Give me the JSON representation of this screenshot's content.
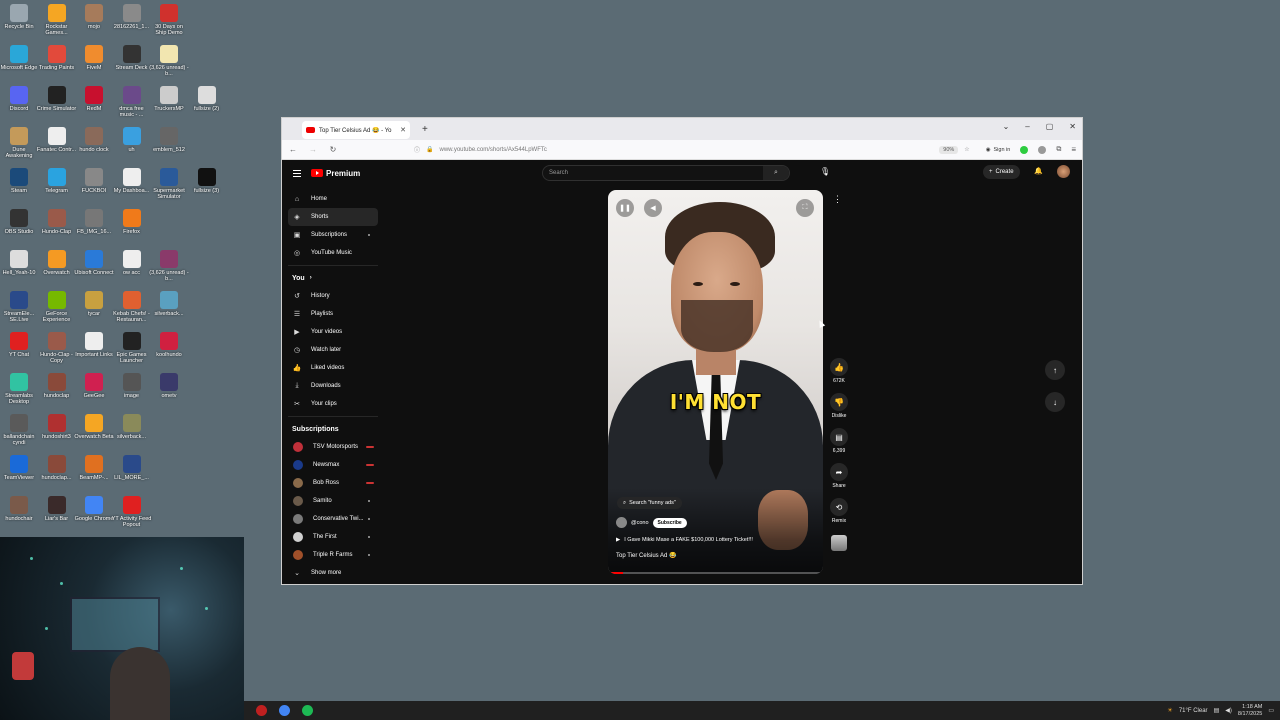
{
  "desktop": {
    "icons": [
      {
        "label": "Recycle Bin",
        "color": "#9aa7b0",
        "col": 0,
        "row": 0
      },
      {
        "label": "Rockstar Games...",
        "color": "#f5a623",
        "col": 1,
        "row": 0
      },
      {
        "label": "mojo",
        "color": "#a67b5b",
        "col": 2,
        "row": 0
      },
      {
        "label": "28162261_1...",
        "color": "#8a8a8a",
        "col": 3,
        "row": 0
      },
      {
        "label": "30 Days on Ship Demo",
        "color": "#d0312d",
        "col": 4,
        "row": 0
      },
      {
        "label": "Microsoft Edge",
        "color": "#2aa7d8",
        "col": 0,
        "row": 1
      },
      {
        "label": "Trading Paints",
        "color": "#e24a3b",
        "col": 1,
        "row": 1
      },
      {
        "label": "FiveM",
        "color": "#f08c2e",
        "col": 2,
        "row": 1
      },
      {
        "label": "Stream Deck",
        "color": "#333333",
        "col": 3,
        "row": 1
      },
      {
        "label": "(3,626 unread) - b...",
        "color": "#f2e6b0",
        "col": 4,
        "row": 1
      },
      {
        "label": "Discord",
        "color": "#5865f2",
        "col": 0,
        "row": 2
      },
      {
        "label": "Crime Simulator",
        "color": "#222222",
        "col": 1,
        "row": 2
      },
      {
        "label": "RedM",
        "color": "#c8102e",
        "col": 2,
        "row": 2
      },
      {
        "label": "dmca free music - ...",
        "color": "#6b4a8a",
        "col": 3,
        "row": 2
      },
      {
        "label": "TruckersMP",
        "color": "#cccccc",
        "col": 4,
        "row": 2
      },
      {
        "label": "fullsize (2)",
        "color": "#dddddd",
        "col": 5,
        "row": 2
      },
      {
        "label": "Dune Awakening",
        "color": "#c49a5a",
        "col": 0,
        "row": 3
      },
      {
        "label": "Fanatec Contr...",
        "color": "#eeeeee",
        "col": 1,
        "row": 3
      },
      {
        "label": "hundo clock",
        "color": "#8a6a5a",
        "col": 2,
        "row": 3
      },
      {
        "label": "uh",
        "color": "#3aa0e0",
        "col": 3,
        "row": 3
      },
      {
        "label": "emblem_512",
        "color": "#666666",
        "col": 4,
        "row": 3
      },
      {
        "label": "Steam",
        "color": "#1b4a7a",
        "col": 0,
        "row": 4
      },
      {
        "label": "Telegram",
        "color": "#2aa3e0",
        "col": 1,
        "row": 4
      },
      {
        "label": "FUCKBOI",
        "color": "#888888",
        "col": 2,
        "row": 4
      },
      {
        "label": "My Dashboa...",
        "color": "#eeeeee",
        "col": 3,
        "row": 4
      },
      {
        "label": "Supermarket Simulator",
        "color": "#2a5a9a",
        "col": 4,
        "row": 4
      },
      {
        "label": "fullsize (3)",
        "color": "#111111",
        "col": 5,
        "row": 4
      },
      {
        "label": "OBS Studio",
        "color": "#333333",
        "col": 0,
        "row": 5
      },
      {
        "label": "Hundo-Clap",
        "color": "#9a5a4a",
        "col": 1,
        "row": 5
      },
      {
        "label": "FB_IMG_16...",
        "color": "#777777",
        "col": 2,
        "row": 5
      },
      {
        "label": "Firefox",
        "color": "#f07a1a",
        "col": 3,
        "row": 5
      },
      {
        "label": "Hell_Yeah-10",
        "color": "#dddddd",
        "col": 0,
        "row": 6
      },
      {
        "label": "Overwatch",
        "color": "#f59a23",
        "col": 1,
        "row": 6
      },
      {
        "label": "Ubisoft Connect",
        "color": "#2a7ad8",
        "col": 2,
        "row": 6
      },
      {
        "label": "ow acc",
        "color": "#eeeeee",
        "col": 3,
        "row": 6
      },
      {
        "label": "(3,626 unread) - b...",
        "color": "#8a3a6a",
        "col": 4,
        "row": 6
      },
      {
        "label": "StreamEle... SE.Live",
        "color": "#2a4a8a",
        "col": 0,
        "row": 7
      },
      {
        "label": "GeForce Experience",
        "color": "#76b900",
        "col": 1,
        "row": 7
      },
      {
        "label": "tycar",
        "color": "#c8a040",
        "col": 2,
        "row": 7
      },
      {
        "label": "Kebab Chefs! - Restauran...",
        "color": "#e06030",
        "col": 3,
        "row": 7
      },
      {
        "label": "silverback...",
        "color": "#5aa0c0",
        "col": 4,
        "row": 7
      },
      {
        "label": "YT Chat",
        "color": "#e02020",
        "col": 0,
        "row": 8
      },
      {
        "label": "Hundo-Clap - Copy",
        "color": "#9a5a4a",
        "col": 1,
        "row": 8
      },
      {
        "label": "Important Links",
        "color": "#eeeeee",
        "col": 2,
        "row": 8
      },
      {
        "label": "Epic Games Launcher",
        "color": "#222222",
        "col": 3,
        "row": 8
      },
      {
        "label": "koolhundo",
        "color": "#d02040",
        "col": 4,
        "row": 8
      },
      {
        "label": "Streamlabs Desktop",
        "color": "#31c3a2",
        "col": 0,
        "row": 9
      },
      {
        "label": "hundoclap",
        "color": "#8a4a3a",
        "col": 1,
        "row": 9
      },
      {
        "label": "GeeGee",
        "color": "#d02050",
        "col": 2,
        "row": 9
      },
      {
        "label": "image",
        "color": "#555555",
        "col": 3,
        "row": 9
      },
      {
        "label": "ometv",
        "color": "#3a3a6a",
        "col": 4,
        "row": 9
      },
      {
        "label": "ballandchain cyndi",
        "color": "#5a5a5a",
        "col": 0,
        "row": 10
      },
      {
        "label": "hundoshirt3",
        "color": "#b03030",
        "col": 1,
        "row": 10
      },
      {
        "label": "Overwatch Beta",
        "color": "#f5a623",
        "col": 2,
        "row": 10
      },
      {
        "label": "silverback...",
        "color": "#8a8a5a",
        "col": 3,
        "row": 10
      },
      {
        "label": "TeamViewer",
        "color": "#1a6ad8",
        "col": 0,
        "row": 11
      },
      {
        "label": "hundoclap...",
        "color": "#8a4a3a",
        "col": 1,
        "row": 11
      },
      {
        "label": "BeamMP-...",
        "color": "#e07020",
        "col": 2,
        "row": 11
      },
      {
        "label": "LIL_MORE_...",
        "color": "#2a4a8a",
        "col": 3,
        "row": 11
      },
      {
        "label": "hundochair",
        "color": "#7a5a4a",
        "col": 0,
        "row": 12
      },
      {
        "label": "Liar's Bar",
        "color": "#3a2a2a",
        "col": 1,
        "row": 12
      },
      {
        "label": "Google Chrome",
        "color": "#4285f4",
        "col": 2,
        "row": 12
      },
      {
        "label": "YT Activity Feed Popout",
        "color": "#e02020",
        "col": 3,
        "row": 12
      }
    ]
  },
  "taskbar": {
    "weather": "71°F Clear",
    "time": "1:18 AM",
    "date": "8/17/2025"
  },
  "browser": {
    "tab_title": "Top Tier Celsius Ad 😂 - Yo",
    "tab_close": "✕",
    "new_tab": "+",
    "url": "www.youtube.com/shorts/Ax544LpWFTc",
    "zoom": "90%",
    "sign_in": "Sign in"
  },
  "youtube": {
    "logo_text": "Premium",
    "search_placeholder": "Search",
    "create_label": "Create",
    "nav": [
      {
        "label": "Home",
        "icon": "⌂"
      },
      {
        "label": "Shorts",
        "icon": "◈"
      },
      {
        "label": "Subscriptions",
        "icon": "▣"
      },
      {
        "label": "YouTube Music",
        "icon": "◎"
      }
    ],
    "you_heading": "You",
    "you_items": [
      {
        "label": "History",
        "icon": "↺"
      },
      {
        "label": "Playlists",
        "icon": "☰"
      },
      {
        "label": "Your videos",
        "icon": "▶"
      },
      {
        "label": "Watch later",
        "icon": "◷"
      },
      {
        "label": "Liked videos",
        "icon": "👍"
      },
      {
        "label": "Downloads",
        "icon": "⤓"
      },
      {
        "label": "Your clips",
        "icon": "✂"
      }
    ],
    "subs_heading": "Subscriptions",
    "subscriptions": [
      {
        "label": "TSV Motorsports",
        "color": "#c0303a",
        "status": "live"
      },
      {
        "label": "Newsmax",
        "color": "#1a3a8a",
        "status": "live"
      },
      {
        "label": "Bob Ross",
        "color": "#8a6a4a",
        "status": "live"
      },
      {
        "label": "Samito",
        "color": "#6a5a4a",
        "status": "dot"
      },
      {
        "label": "Conservative Twi...",
        "color": "#7a7a7a",
        "status": "dot"
      },
      {
        "label": "The First",
        "color": "#d0d0d0",
        "status": "dot"
      },
      {
        "label": "Triple R Farms",
        "color": "#a0502a",
        "status": "dot"
      }
    ],
    "show_more": "Show more",
    "short": {
      "caption": "I'M NOT",
      "search_pill": "Search \"funny ads\"",
      "channel": "@cono",
      "subscribe": "Subscribe",
      "description": "I Gave Mikki Mase a FAKE $100,000 Lottery Ticket!!!",
      "title": "Top Tier Celsius Ad 😂",
      "progress": 0.07
    },
    "actions": {
      "likes": "672K",
      "dislike": "Dislike",
      "comments": "6,399",
      "share": "Share",
      "remix": "Remix"
    }
  }
}
